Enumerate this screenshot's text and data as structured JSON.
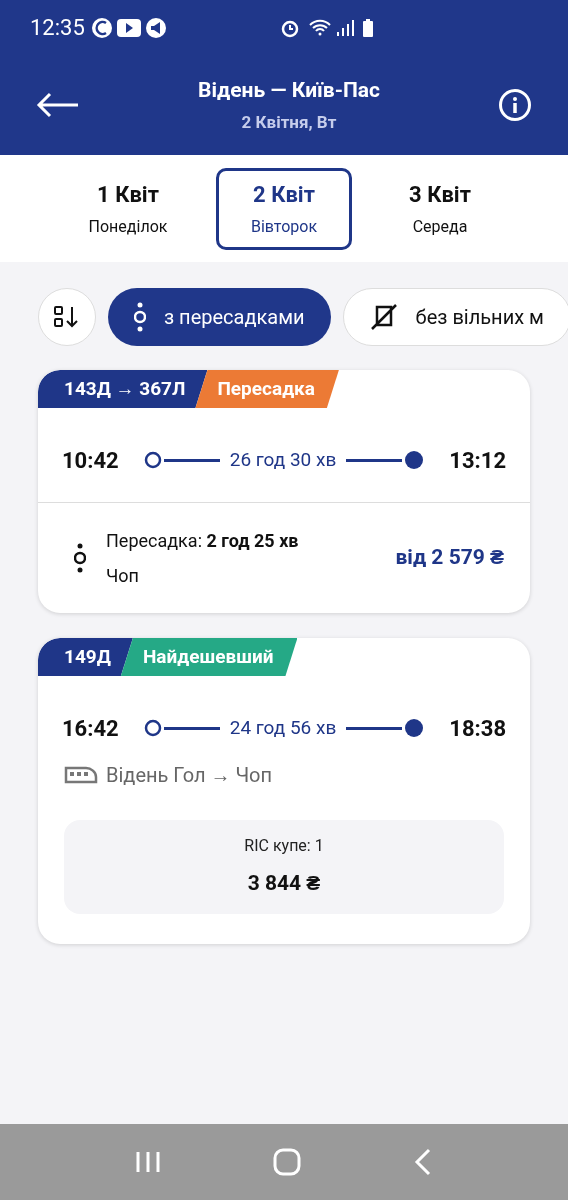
{
  "status_bar": {
    "time": "12:35"
  },
  "header": {
    "title": "Відень — Київ-Пас",
    "subtitle": "2 Квітня, Вт"
  },
  "dates": [
    {
      "day": "1 Квіт",
      "weekday": "Понеділок",
      "selected": false
    },
    {
      "day": "2 Квіт",
      "weekday": "Вівторок",
      "selected": true
    },
    {
      "day": "3 Квіт",
      "weekday": "Середа",
      "selected": false
    }
  ],
  "filters": [
    {
      "kind": "transfers",
      "label": "з пересадками",
      "selected": true
    },
    {
      "kind": "no_seats",
      "label": "без вільних м",
      "selected": false
    }
  ],
  "trips": [
    {
      "kind": "transfer",
      "train": "143Д → 367Л",
      "badge": {
        "label": "Пересадка",
        "color": "#ec7a35"
      },
      "depart": "10:42",
      "duration": "26 год 30 хв",
      "arrive": "13:12",
      "transfer": "Пересадка: **2 год 25 хв**",
      "station": "Чоп",
      "price": "від 2 579 ₴"
    },
    {
      "kind": "direct",
      "train": "149Д",
      "badge": {
        "label": "Найдешевший",
        "color": "#25a986"
      },
      "depart": "16:42",
      "duration": "24 год 56 хв",
      "arrive": "18:38",
      "route": "Відень Гол → Чоп",
      "seat_class": "RIC купе: 1",
      "price": "3 844 ₴"
    }
  ]
}
